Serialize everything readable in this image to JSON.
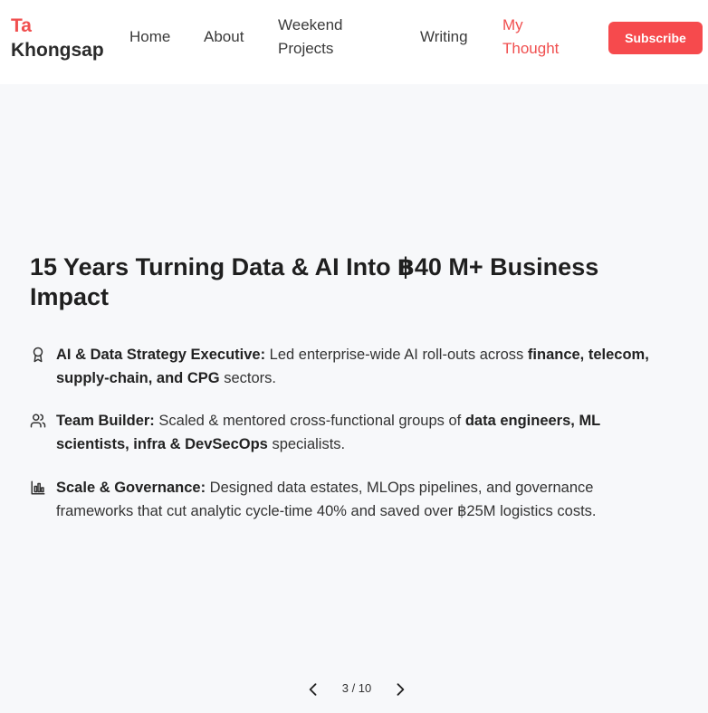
{
  "brand": {
    "first": "Ta",
    "last": "Khongsap"
  },
  "nav": {
    "home": "Home",
    "about": "About",
    "weekend_1": "Weekend",
    "weekend_2": "Projects",
    "writing": "Writing",
    "thought_1": "My",
    "thought_2": "Thought",
    "subscribe": "Subscribe"
  },
  "slide": {
    "title_line1": "15 Years Turning Data & AI Into ฿40 M+ Business",
    "title_line2": "Impact",
    "points": [
      {
        "icon": "award-icon",
        "lead": "AI & Data Strategy Executive:",
        "t1": " Led enterprise-wide AI roll-outs across ",
        "b1": "finance, telecom,",
        "b2": "supply-chain, and CPG",
        "t2": " sectors."
      },
      {
        "icon": "users-icon",
        "lead": "Team Builder:",
        "t1": " Scaled & mentored cross-functional groups of ",
        "b1": "data engineers, ML",
        "b2": "scientists, infra & DevSecOps",
        "t2": " specialists."
      },
      {
        "icon": "bar-chart-icon",
        "lead": "Scale & Governance:",
        "t1": " Designed data estates, MLOps pipelines, and governance",
        "t2": "frameworks that cut analytic cycle-time 40% and saved over ฿25M logistics costs."
      }
    ]
  },
  "pager": {
    "label": "3 / 10",
    "current": 3,
    "total": 10
  },
  "colors": {
    "accent": "#f04f4f",
    "button": "#f64a4d",
    "background": "#f7f8fa"
  }
}
